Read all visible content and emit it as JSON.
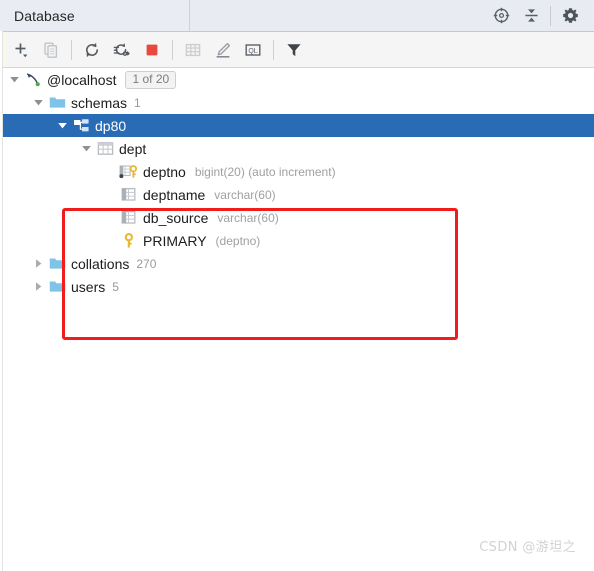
{
  "window": {
    "title": "Database"
  },
  "header_actions": [
    {
      "name": "scroll-from-source-icon",
      "label": "Scroll from Source"
    },
    {
      "name": "collapse-all-icon",
      "label": "Collapse All"
    },
    {
      "name": "gear-icon",
      "label": "Settings"
    }
  ],
  "toolbar": {
    "buttons": [
      {
        "name": "add-button",
        "label": "New"
      },
      {
        "name": "copy-button",
        "label": "Duplicate"
      },
      {
        "name": "refresh-button",
        "label": "Refresh"
      },
      {
        "name": "sync-settings-button",
        "label": "Synchronize"
      },
      {
        "name": "stop-button",
        "label": "Stop"
      },
      {
        "name": "table-editor-button",
        "label": "Open Table Editor"
      },
      {
        "name": "modify-button",
        "label": "Modify"
      },
      {
        "name": "query-console-button",
        "label": "Open Query Console"
      },
      {
        "name": "filter-button",
        "label": "Filter"
      }
    ]
  },
  "tree": {
    "rows": [
      {
        "id": "localhost",
        "level": 1,
        "expanded": true,
        "icon": "mysql-connection-icon",
        "label": "@localhost",
        "badge": "1 of 20",
        "count": "",
        "type": "",
        "selected": false
      },
      {
        "id": "schemas",
        "level": 2,
        "expanded": true,
        "icon": "folder-icon",
        "label": "schemas",
        "badge": "",
        "count": "1",
        "type": "",
        "selected": false
      },
      {
        "id": "dp80",
        "level": 3,
        "expanded": true,
        "icon": "schema-icon",
        "label": "dp80",
        "badge": "",
        "count": "",
        "type": "",
        "selected": true
      },
      {
        "id": "dept",
        "level": 4,
        "expanded": true,
        "icon": "table-icon",
        "label": "dept",
        "badge": "",
        "count": "",
        "type": "",
        "selected": false
      },
      {
        "id": "deptno",
        "level": 5,
        "expanded": null,
        "icon": "column-key-icon",
        "label": "deptno",
        "badge": "",
        "count": "",
        "type": "bigint(20) (auto increment)",
        "selected": false
      },
      {
        "id": "deptname",
        "level": 5,
        "expanded": null,
        "icon": "column-icon",
        "label": "deptname",
        "badge": "",
        "count": "",
        "type": "varchar(60)",
        "selected": false
      },
      {
        "id": "db_source",
        "level": 5,
        "expanded": null,
        "icon": "column-icon",
        "label": "db_source",
        "badge": "",
        "count": "",
        "type": "varchar(60)",
        "selected": false
      },
      {
        "id": "primary",
        "level": 5,
        "expanded": null,
        "icon": "key-icon",
        "label": "PRIMARY",
        "badge": "",
        "count": "",
        "type": "(deptno)",
        "selected": false
      },
      {
        "id": "collations",
        "level": 2,
        "expanded": false,
        "icon": "folder-icon",
        "label": "collations",
        "badge": "",
        "count": "270",
        "type": "",
        "selected": false
      },
      {
        "id": "users",
        "level": 2,
        "expanded": false,
        "icon": "folder-icon",
        "label": "users",
        "badge": "",
        "count": "5",
        "type": "",
        "selected": false
      }
    ]
  },
  "annotation": {
    "name": "red-highlight-rectangle",
    "color": "#f11c1c"
  },
  "watermark": {
    "text": "CSDN @游坦之"
  },
  "colors": {
    "selection": "#2a6bb5",
    "folder": "#7fc4e8",
    "key": "#e8b831",
    "stop": "#e8483f",
    "header_bg": "#e8ecf2",
    "toolbar_bg": "#f5f5f5"
  }
}
